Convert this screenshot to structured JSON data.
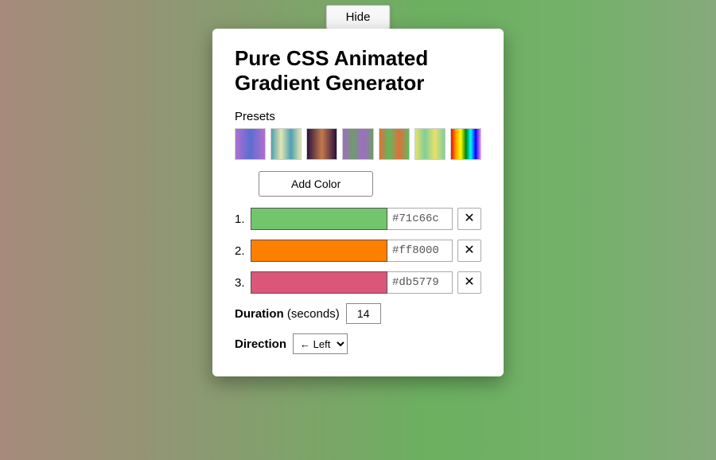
{
  "hide_btn": "Hide",
  "title": "Pure CSS Animated Gradient Generator",
  "presets_label": "Presets",
  "add_color_label": "Add Color",
  "colors": [
    {
      "num": "1.",
      "hex": "#71c66c",
      "swatch": "#71c66c"
    },
    {
      "num": "2.",
      "hex": "#ff8000",
      "swatch": "#ff8000"
    },
    {
      "num": "3.",
      "hex": "#db5779",
      "swatch": "#db5779"
    }
  ],
  "remove_icon": "✕",
  "duration": {
    "label_bold": "Duration",
    "label_paren": "(seconds)",
    "value": "14"
  },
  "direction": {
    "label": "Direction",
    "value": "← Left"
  }
}
